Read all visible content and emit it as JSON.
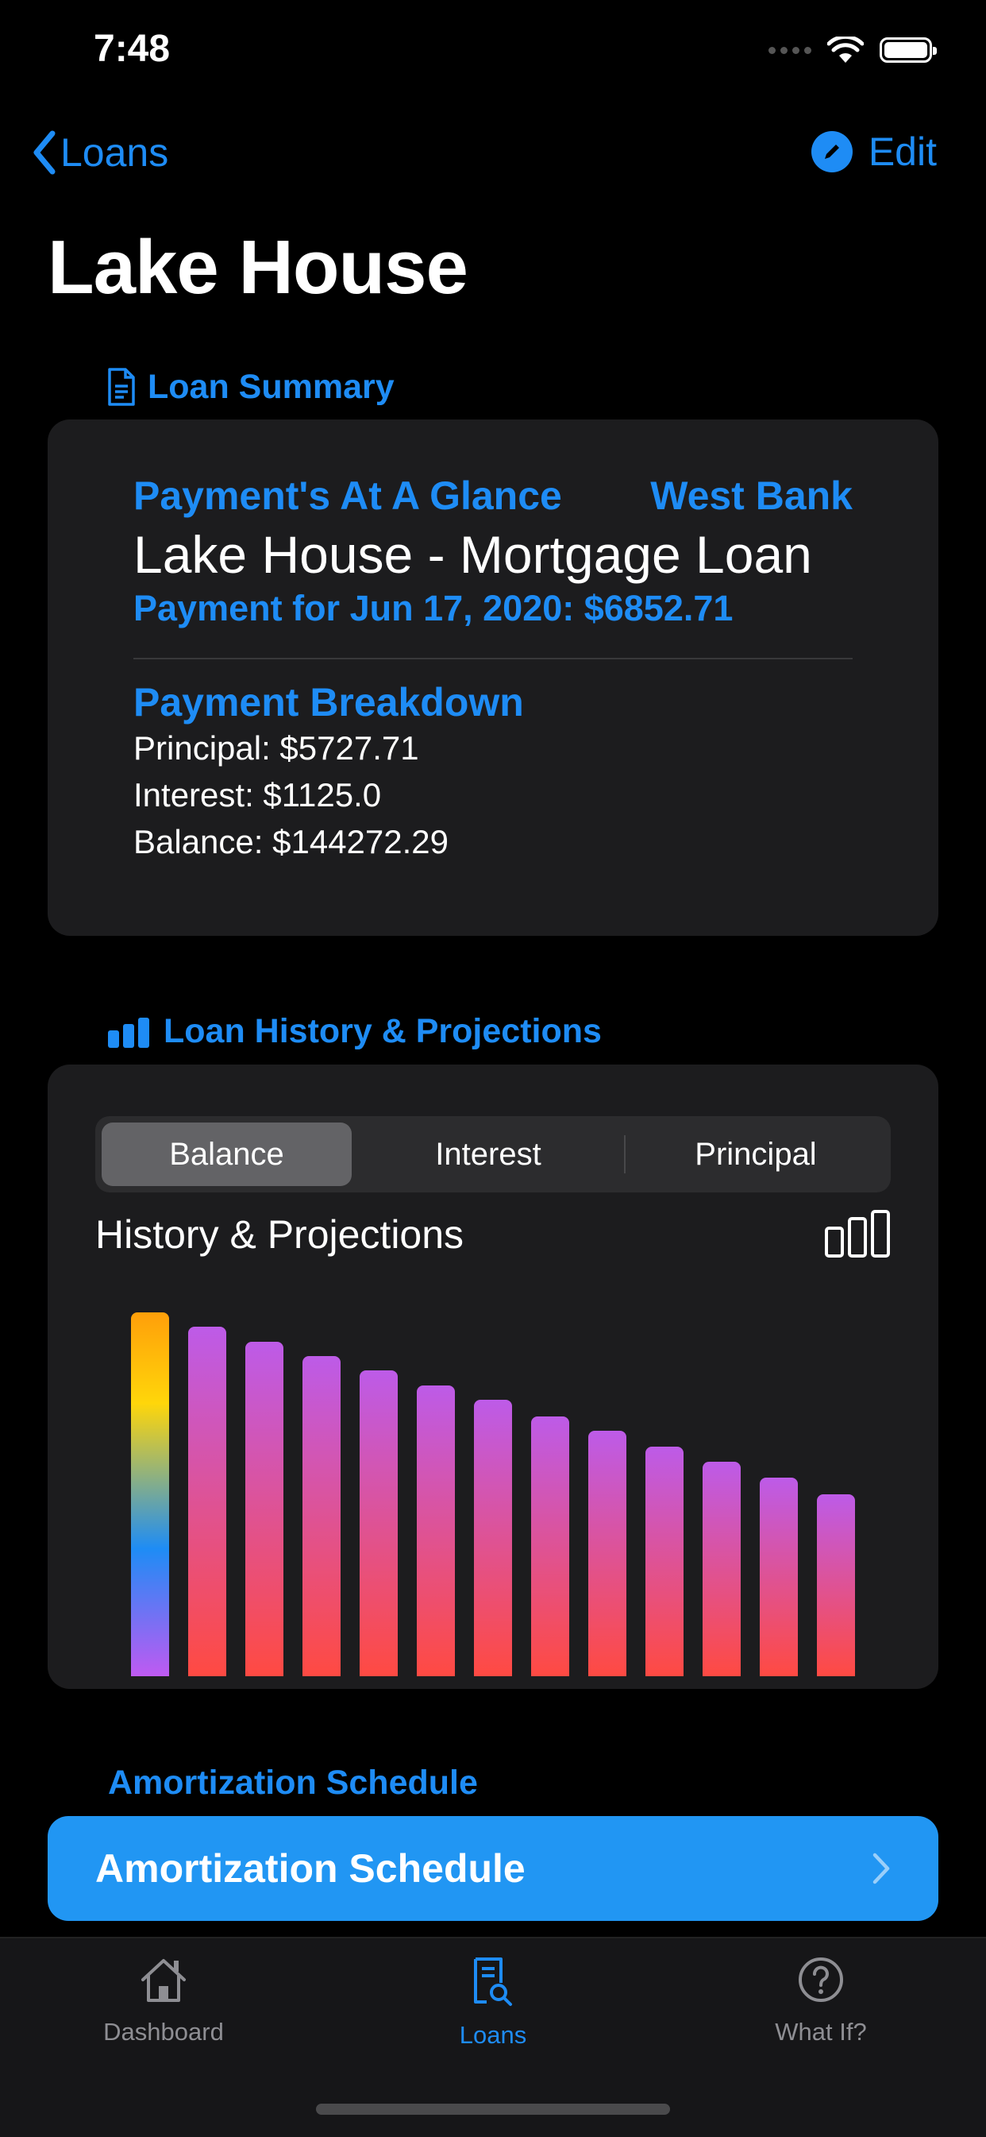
{
  "status_bar": {
    "time": "7:48"
  },
  "nav": {
    "back_label": "Loans",
    "edit_label": "Edit"
  },
  "page": {
    "title": "Lake House"
  },
  "loan_summary": {
    "section_title": "Loan Summary",
    "glance_label": "Payment's At A Glance",
    "bank": "West Bank",
    "loan_name": "Lake House - Mortgage Loan",
    "payment_line": "Payment for Jun 17, 2020: $6852.71",
    "breakdown_title": "Payment Breakdown",
    "principal": "Principal: $5727.71",
    "interest": "Interest: $1125.0",
    "balance": "Balance: $144272.29"
  },
  "history": {
    "section_title": "Loan History & Projections",
    "segments": [
      "Balance",
      "Interest",
      "Principal"
    ],
    "selected_segment": "Balance",
    "chart_title": "History & Projections"
  },
  "chart_data": {
    "type": "bar",
    "values": [
      100,
      96,
      92,
      88,
      84,
      80,
      76,
      71.5,
      67.5,
      63,
      59,
      54.5,
      50
    ],
    "current_index": 0,
    "colors": {
      "current": [
        "#ff9f0a",
        "#ffd60a",
        "#1e8cf5",
        "#bf5af2"
      ],
      "projection": [
        "#bd5be8",
        "#ff4a42"
      ]
    }
  },
  "amortization": {
    "section_title": "Amortization Schedule",
    "button_label": "Amortization Schedule"
  },
  "tabbar": {
    "items": [
      {
        "label": "Dashboard",
        "icon": "house-icon"
      },
      {
        "label": "Loans",
        "icon": "document-search-icon"
      },
      {
        "label": "What If?",
        "icon": "question-circle-icon"
      }
    ],
    "active": "Loans"
  },
  "colors": {
    "accent": "#1e8cf5",
    "button": "#2196f3",
    "card": "#1c1c1e"
  }
}
